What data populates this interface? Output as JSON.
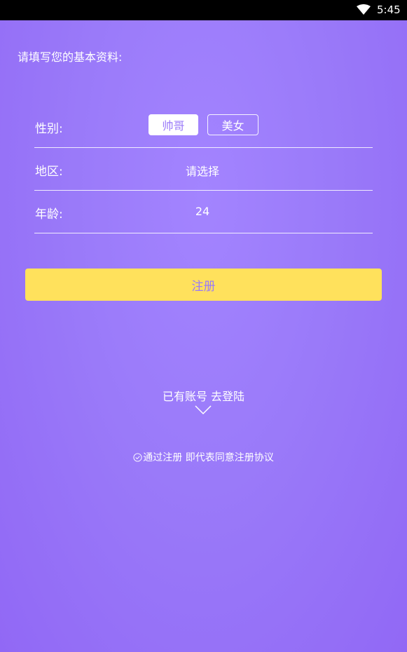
{
  "status_bar": {
    "time": "5:45",
    "wifi_icon": "wifi-icon"
  },
  "intro_text": "请填写您的基本资料:",
  "form": {
    "gender": {
      "label": "性别:",
      "options": [
        "帅哥",
        "美女"
      ],
      "selected": "帅哥"
    },
    "region": {
      "label": "地区:",
      "value": "请选择"
    },
    "age": {
      "label": "年龄:",
      "value": "24"
    }
  },
  "register_button": "注册",
  "login_link": "已有账号 去登陆",
  "agreement": {
    "icon": "check-circle-icon",
    "text": "通过注册 即代表同意注册协议"
  },
  "colors": {
    "background": "#9a7af9",
    "button_yellow": "#ffe15c",
    "button_text": "#9a7af9",
    "text": "#ffffff"
  }
}
